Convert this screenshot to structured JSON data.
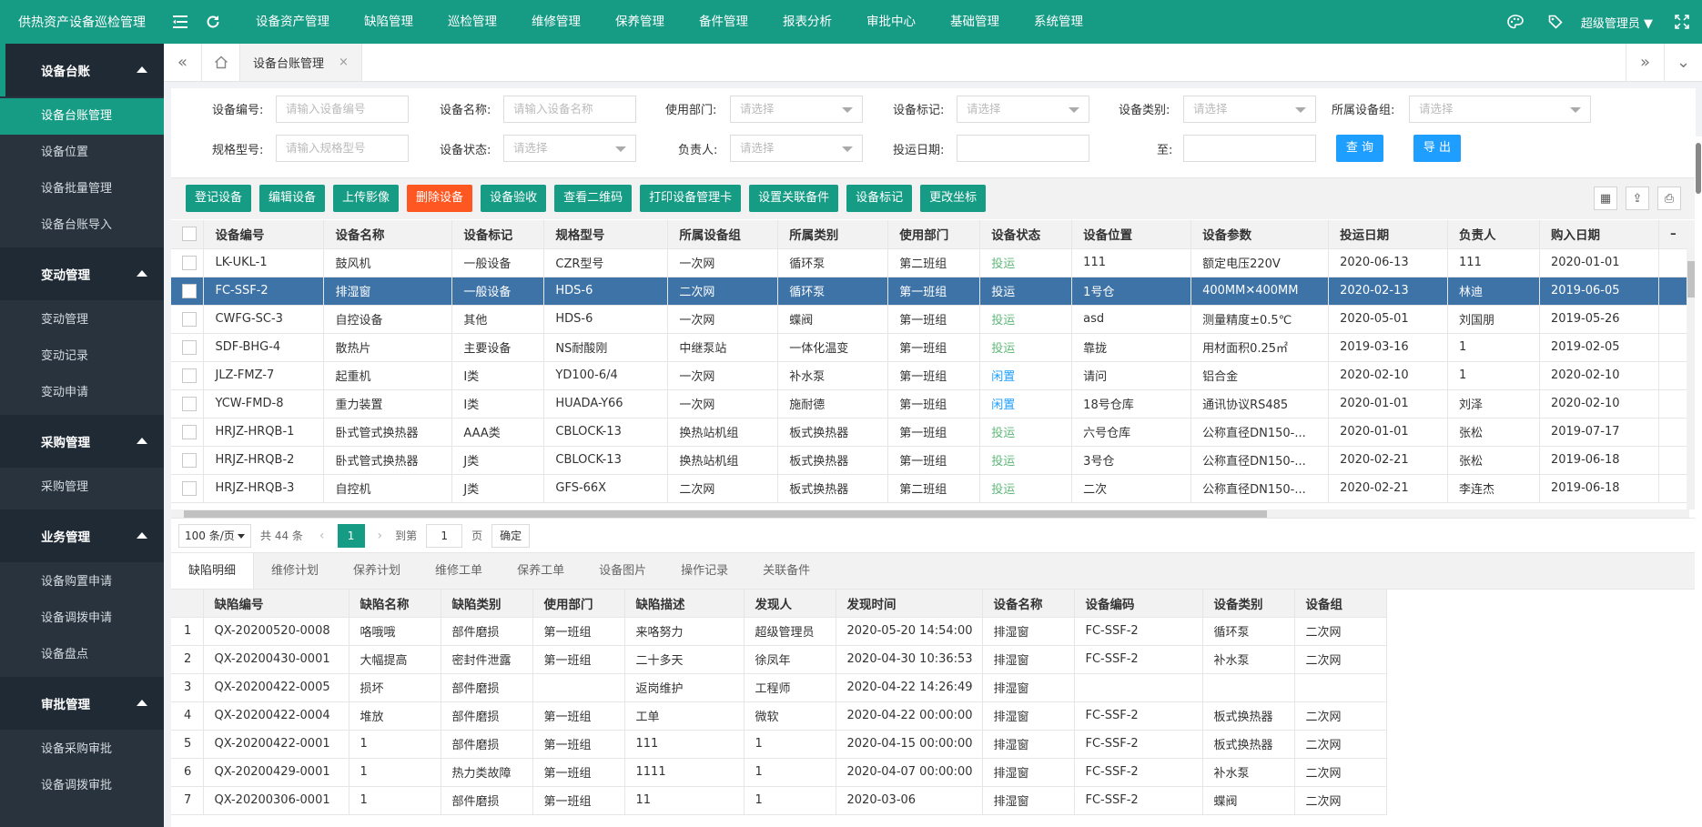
{
  "app": {
    "title": "供热资产设备巡检管理",
    "accent": "#169b85",
    "danger": "#ff5722",
    "selected_row": "#3e73a8"
  },
  "topnav": [
    "设备资产管理",
    "缺陷管理",
    "巡检管理",
    "维修管理",
    "保养管理",
    "备件管理",
    "报表分析",
    "审批中心",
    "基础管理",
    "系统管理"
  ],
  "topbar": {
    "user": "超级管理员",
    "icons": [
      "menu-icon",
      "refresh-icon",
      "palette-icon",
      "tag-icon",
      "fullscreen-icon"
    ]
  },
  "sidebar": [
    {
      "title": "设备台账",
      "items": [
        "设备台账管理",
        "设备位置",
        "设备批量管理",
        "设备台账导入"
      ]
    },
    {
      "title": "变动管理",
      "items": [
        "变动管理",
        "变动记录",
        "变动申请"
      ]
    },
    {
      "title": "采购管理",
      "items": [
        "采购管理"
      ]
    },
    {
      "title": "业务管理",
      "items": [
        "设备购置申请",
        "设备调拨申请",
        "设备盘点"
      ]
    },
    {
      "title": "审批管理",
      "items": [
        "设备采购审批",
        "设备调拨审批"
      ]
    }
  ],
  "tabs": {
    "current": "设备台账管理",
    "close": "×"
  },
  "filters": {
    "device_no": {
      "label": "设备编号:",
      "placeholder": "请输入设备编号"
    },
    "device_name": {
      "label": "设备名称:",
      "placeholder": "请输入设备名称"
    },
    "dept": {
      "label": "使用部门:",
      "placeholder": "请选择"
    },
    "mark": {
      "label": "设备标记:",
      "placeholder": "请选择"
    },
    "category": {
      "label": "设备类别:",
      "placeholder": "请选择"
    },
    "group": {
      "label": "所属设备组:",
      "placeholder": "请选择"
    },
    "model": {
      "label": "规格型号:",
      "placeholder": "请输入规格型号"
    },
    "status": {
      "label": "设备状态:",
      "placeholder": "请选择"
    },
    "owner": {
      "label": "负责人:",
      "placeholder": "请选择"
    },
    "date_from": {
      "label": "投运日期:",
      "value": ""
    },
    "date_to": {
      "label": "至:",
      "value": ""
    },
    "query": "查 询",
    "export": "导 出"
  },
  "toolbar": [
    "登记设备",
    "编辑设备",
    "上传影像",
    "删除设备",
    "设备验收",
    "查看二维码",
    "打印设备管理卡",
    "设置关联备件",
    "设备标记",
    "更改坐标"
  ],
  "toolbar_icons": [
    "columns-icon",
    "export-icon",
    "print-icon"
  ],
  "main_table": {
    "columns": [
      "设备编号",
      "设备名称",
      "设备标记",
      "规格型号",
      "所属设备组",
      "所属类别",
      "使用部门",
      "设备状态",
      "设备位置",
      "设备参数",
      "投运日期",
      "负责人",
      "购入日期"
    ],
    "rows": [
      [
        "LK-UKL-1",
        "鼓风机",
        "一般设备",
        "CZR型号",
        "一次网",
        "循环泵",
        "第二班组",
        "投运",
        "111",
        "额定电压220V",
        "2020-06-13",
        "111",
        "2020-01-01"
      ],
      [
        "FC-SSF-2",
        "排湿窗",
        "一般设备",
        "HDS-6",
        "二次网",
        "循环泵",
        "第一班组",
        "投运",
        "1号仓",
        "400MM✕400MM",
        "2020-02-13",
        "林迪",
        "2019-06-05"
      ],
      [
        "CWFG-SC-3",
        "自控设备",
        "其他",
        "HDS-6",
        "一次网",
        "蝶阀",
        "第一班组",
        "投运",
        "asd",
        "测量精度±0.5℃",
        "2020-05-01",
        "刘国朋",
        "2019-05-26"
      ],
      [
        "SDF-BHG-4",
        "散热片",
        "主要设备",
        "NS耐酸刚",
        "中继泵站",
        "一体化温变",
        "第一班组",
        "投运",
        "靠拢",
        "用材面积0.25㎡",
        "2019-03-16",
        "1",
        "2019-02-05"
      ],
      [
        "JLZ-FMZ-7",
        "起重机",
        "I类",
        "YD100-6/4",
        "一次网",
        "补水泵",
        "第一班组",
        "闲置",
        "请问",
        "铝合金",
        "2020-02-10",
        "1",
        "2020-02-10"
      ],
      [
        "YCW-FMD-8",
        "重力装置",
        "I类",
        "HUADA-Y66",
        "一次网",
        "施耐德",
        "第一班组",
        "闲置",
        "18号仓库",
        "通讯协议RS485",
        "2020-01-01",
        "刘泽",
        "2020-02-10"
      ],
      [
        "HRJZ-HRQB-1",
        "卧式管式换热器",
        "AAA类",
        "CBLOCK-13",
        "换热站机组",
        "板式换热器",
        "第一班组",
        "投运",
        "六号仓库",
        "公称直径DN150-...",
        "2020-01-01",
        "张松",
        "2019-07-17"
      ],
      [
        "HRJZ-HRQB-2",
        "卧式管式换热器",
        "J类",
        "CBLOCK-13",
        "换热站机组",
        "板式换热器",
        "第一班组",
        "投运",
        "3号仓",
        "公称直径DN150-...",
        "2020-02-21",
        "张松",
        "2019-06-18"
      ],
      [
        "HRJZ-HRQB-3",
        "自控机",
        "J类",
        "GFS-66X",
        "二次网",
        "板式换热器",
        "第二班组",
        "投运",
        "二次",
        "公称直径DN150-...",
        "2020-02-21",
        "李连杰",
        "2019-06-18"
      ]
    ]
  },
  "pager": {
    "size": "100 条/页",
    "total": "共 44 条",
    "current": "1",
    "goto": "到第",
    "page_input": "1",
    "page_unit": "页",
    "ok": "确定"
  },
  "subtabs": [
    "缺陷明细",
    "维修计划",
    "保养计划",
    "维修工单",
    "保养工单",
    "设备图片",
    "操作记录",
    "关联备件"
  ],
  "defect_table": {
    "columns": [
      "缺陷编号",
      "缺陷名称",
      "缺陷类别",
      "使用部门",
      "缺陷描述",
      "发现人",
      "发现时间",
      "设备名称",
      "设备编码",
      "设备类别",
      "设备组"
    ],
    "rows": [
      [
        "1",
        "QX-20200520-0008",
        "咯哦哦",
        "部件磨损",
        "第一班组",
        "来咯努力",
        "超级管理员",
        "2020-05-20 14:54:00",
        "排湿窗",
        "FC-SSF-2",
        "循环泵",
        "二次网"
      ],
      [
        "2",
        "QX-20200430-0001",
        "大幅提高",
        "密封件泄露",
        "第一班组",
        "二十多天",
        "徐凤年",
        "2020-04-30 10:36:53",
        "排湿窗",
        "FC-SSF-2",
        "补水泵",
        "二次网"
      ],
      [
        "3",
        "QX-20200422-0005",
        "损坏",
        "部件磨损",
        "",
        "返岗维护",
        "工程师",
        "2020-04-22 14:26:49",
        "排湿窗",
        "",
        "",
        ""
      ],
      [
        "4",
        "QX-20200422-0004",
        "堆放",
        "部件磨损",
        "第一班组",
        "工单",
        "微软",
        "2020-04-22 00:00:00",
        "排湿窗",
        "FC-SSF-2",
        "板式换热器",
        "二次网"
      ],
      [
        "5",
        "QX-20200422-0001",
        "1",
        "部件磨损",
        "第一班组",
        "111",
        "1",
        "2020-04-15 00:00:00",
        "排湿窗",
        "FC-SSF-2",
        "板式换热器",
        "二次网"
      ],
      [
        "6",
        "QX-20200429-0001",
        "1",
        "热力类故障",
        "第一班组",
        "1111",
        "1",
        "2020-04-07 00:00:00",
        "排湿窗",
        "FC-SSF-2",
        "补水泵",
        "二次网"
      ],
      [
        "7",
        "QX-20200306-0001",
        "1",
        "部件磨损",
        "第一班组",
        "11",
        "1",
        "2020-03-06",
        "排湿窗",
        "FC-SSF-2",
        "蝶阀",
        "二次网"
      ]
    ]
  }
}
